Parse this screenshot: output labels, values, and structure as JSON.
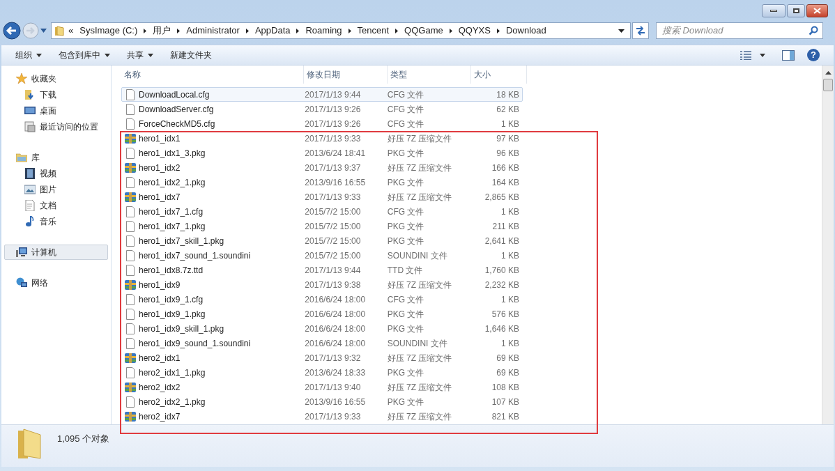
{
  "address_bar": {
    "overflow": "«",
    "crumbs": [
      "SysImage (C:)",
      "用户",
      "Administrator",
      "AppData",
      "Roaming",
      "Tencent",
      "QQGame",
      "QQYXS",
      "Download"
    ]
  },
  "search": {
    "placeholder": "搜索 Download"
  },
  "toolbar": [
    {
      "label": "组织",
      "dropdown": true
    },
    {
      "label": "包含到库中",
      "dropdown": true
    },
    {
      "label": "共享",
      "dropdown": true
    },
    {
      "label": "新建文件夹",
      "dropdown": false
    }
  ],
  "sidebar": [
    {
      "label": "收藏夹",
      "kind": "star",
      "selected": false,
      "children": [
        {
          "label": "下载",
          "kind": "download",
          "selected": false
        },
        {
          "label": "桌面",
          "kind": "desktop",
          "selected": false
        },
        {
          "label": "最近访问的位置",
          "kind": "recent",
          "selected": false
        }
      ]
    },
    {
      "label": "库",
      "kind": "library",
      "selected": false,
      "children": [
        {
          "label": "视频",
          "kind": "video",
          "selected": false
        },
        {
          "label": "图片",
          "kind": "picture",
          "selected": false
        },
        {
          "label": "文档",
          "kind": "document",
          "selected": false
        },
        {
          "label": "音乐",
          "kind": "music",
          "selected": false
        }
      ]
    },
    {
      "label": "计算机",
      "kind": "computer",
      "selected": true
    },
    {
      "label": "网络",
      "kind": "network",
      "selected": false
    }
  ],
  "help_button": "?",
  "table": {
    "columns": [
      "名称",
      "修改日期",
      "类型",
      "大小"
    ],
    "rows": [
      {
        "kind": "file",
        "selected": true,
        "name": "DownloadLocal.cfg",
        "date": "2017/1/13 9:44",
        "type": "CFG 文件",
        "size": "18 KB"
      },
      {
        "kind": "file",
        "selected": false,
        "name": "DownloadServer.cfg",
        "date": "2017/1/13 9:26",
        "type": "CFG 文件",
        "size": "62 KB"
      },
      {
        "kind": "file",
        "selected": false,
        "name": "ForceCheckMD5.cfg",
        "date": "2017/1/13 9:26",
        "type": "CFG 文件",
        "size": "1 KB"
      },
      {
        "kind": "archive",
        "selected": false,
        "name": "hero1_idx1",
        "date": "2017/1/13 9:33",
        "type": "好压 7Z 压缩文件",
        "size": "97 KB"
      },
      {
        "kind": "file",
        "selected": false,
        "name": "hero1_idx1_3.pkg",
        "date": "2013/6/24 18:41",
        "type": "PKG 文件",
        "size": "96 KB"
      },
      {
        "kind": "archive",
        "selected": false,
        "name": "hero1_idx2",
        "date": "2017/1/13 9:37",
        "type": "好压 7Z 压缩文件",
        "size": "166 KB"
      },
      {
        "kind": "file",
        "selected": false,
        "name": "hero1_idx2_1.pkg",
        "date": "2013/9/16 16:55",
        "type": "PKG 文件",
        "size": "164 KB"
      },
      {
        "kind": "archive",
        "selected": false,
        "name": "hero1_idx7",
        "date": "2017/1/13 9:33",
        "type": "好压 7Z 压缩文件",
        "size": "2,865 KB"
      },
      {
        "kind": "file",
        "selected": false,
        "name": "hero1_idx7_1.cfg",
        "date": "2015/7/2 15:00",
        "type": "CFG 文件",
        "size": "1 KB"
      },
      {
        "kind": "file",
        "selected": false,
        "name": "hero1_idx7_1.pkg",
        "date": "2015/7/2 15:00",
        "type": "PKG 文件",
        "size": "211 KB"
      },
      {
        "kind": "file",
        "selected": false,
        "name": "hero1_idx7_skill_1.pkg",
        "date": "2015/7/2 15:00",
        "type": "PKG 文件",
        "size": "2,641 KB"
      },
      {
        "kind": "file",
        "selected": false,
        "name": "hero1_idx7_sound_1.soundini",
        "date": "2015/7/2 15:00",
        "type": "SOUNDINI 文件",
        "size": "1 KB"
      },
      {
        "kind": "file",
        "selected": false,
        "name": "hero1_idx8.7z.ttd",
        "date": "2017/1/13 9:44",
        "type": "TTD 文件",
        "size": "1,760 KB"
      },
      {
        "kind": "archive",
        "selected": false,
        "name": "hero1_idx9",
        "date": "2017/1/13 9:38",
        "type": "好压 7Z 压缩文件",
        "size": "2,232 KB"
      },
      {
        "kind": "file",
        "selected": false,
        "name": "hero1_idx9_1.cfg",
        "date": "2016/6/24 18:00",
        "type": "CFG 文件",
        "size": "1 KB"
      },
      {
        "kind": "file",
        "selected": false,
        "name": "hero1_idx9_1.pkg",
        "date": "2016/6/24 18:00",
        "type": "PKG 文件",
        "size": "576 KB"
      },
      {
        "kind": "file",
        "selected": false,
        "name": "hero1_idx9_skill_1.pkg",
        "date": "2016/6/24 18:00",
        "type": "PKG 文件",
        "size": "1,646 KB"
      },
      {
        "kind": "file",
        "selected": false,
        "name": "hero1_idx9_sound_1.soundini",
        "date": "2016/6/24 18:00",
        "type": "SOUNDINI 文件",
        "size": "1 KB"
      },
      {
        "kind": "archive",
        "selected": false,
        "name": "hero2_idx1",
        "date": "2017/1/13 9:32",
        "type": "好压 7Z 压缩文件",
        "size": "69 KB"
      },
      {
        "kind": "file",
        "selected": false,
        "name": "hero2_idx1_1.pkg",
        "date": "2013/6/24 18:33",
        "type": "PKG 文件",
        "size": "69 KB"
      },
      {
        "kind": "archive",
        "selected": false,
        "name": "hero2_idx2",
        "date": "2017/1/13 9:40",
        "type": "好压 7Z 压缩文件",
        "size": "108 KB"
      },
      {
        "kind": "file",
        "selected": false,
        "name": "hero2_idx2_1.pkg",
        "date": "2013/9/16 16:55",
        "type": "PKG 文件",
        "size": "107 KB"
      },
      {
        "kind": "archive",
        "selected": false,
        "name": "hero2_idx7",
        "date": "2017/1/13 9:33",
        "type": "好压 7Z 压缩文件",
        "size": "821 KB"
      }
    ]
  },
  "status_bar": {
    "count": "1,095 个对象"
  }
}
